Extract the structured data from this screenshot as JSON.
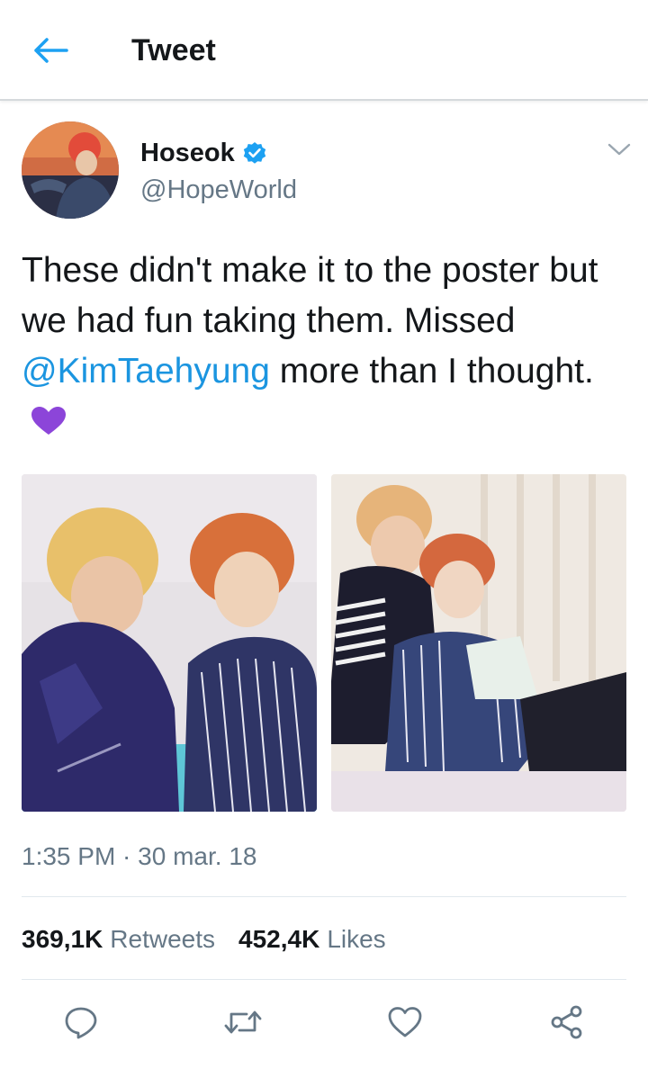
{
  "header": {
    "title": "Tweet",
    "back_icon": "arrow-left-icon"
  },
  "tweet": {
    "author": {
      "display_name": "Hoseok",
      "handle": "@HopeWorld",
      "verified": true
    },
    "text": {
      "part1": "These didn't make it to the poster but we had fun taking them. Missed ",
      "mention": "@KimTaehyung",
      "part2": " more than I thought."
    },
    "emoji": "purple-heart",
    "timestamp": "1:35 PM · 30 mar. 18",
    "stats": {
      "retweets_count": "369,1K",
      "retweets_label": "Retweets",
      "likes_count": "452,4K",
      "likes_label": "Likes"
    },
    "actions": [
      {
        "name": "reply",
        "icon": "reply-icon"
      },
      {
        "name": "retweet",
        "icon": "retweet-icon"
      },
      {
        "name": "like",
        "icon": "heart-icon"
      },
      {
        "name": "share",
        "icon": "share-icon"
      }
    ]
  },
  "colors": {
    "accent": "#1da1f2",
    "mention": "#1b95e0",
    "muted": "#657786",
    "text": "#14171a",
    "heart_emoji": "#8c45d9",
    "divider": "#e1e8ed"
  }
}
